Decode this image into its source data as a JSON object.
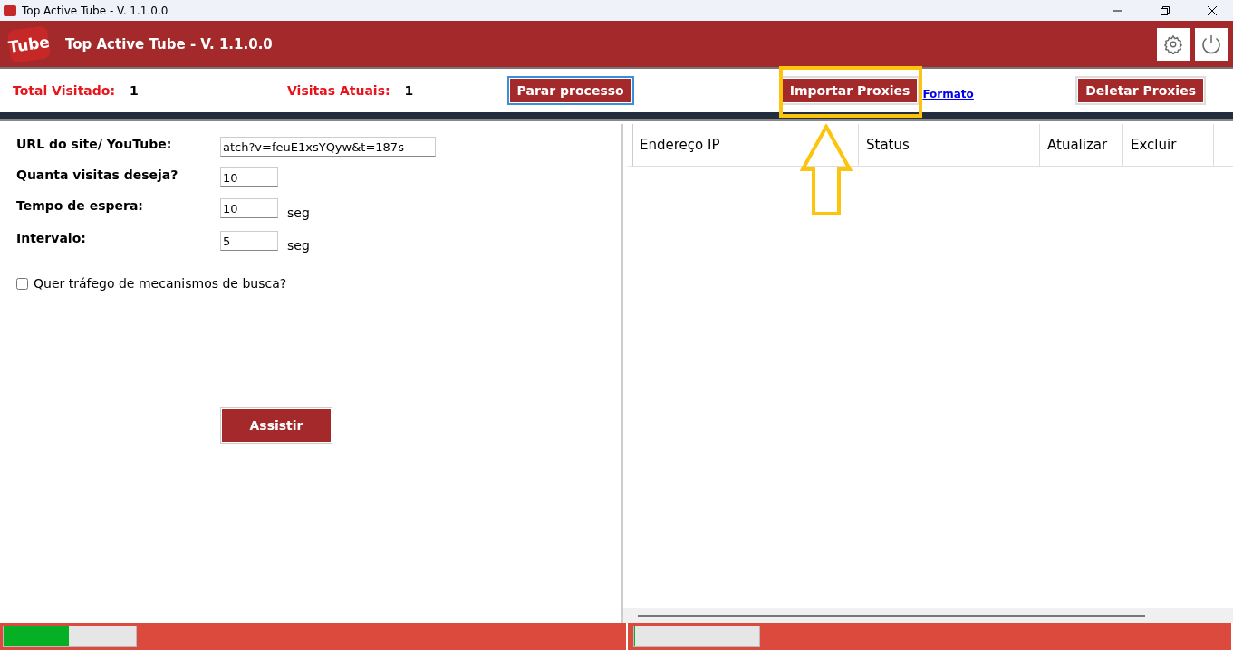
{
  "window": {
    "title": "Top Active Tube - V. 1.1.0.0"
  },
  "header": {
    "logo_text": "Tube",
    "title": "Top Active Tube - V. 1.1.0.0"
  },
  "stats": [
    {
      "label": "Total Visitado:",
      "value": "1"
    },
    {
      "label": "Visitas Atuais:",
      "value": "1"
    }
  ],
  "buttons": {
    "stop": "Parar processo",
    "import": "Importar Proxies",
    "format_link": "Formato",
    "delete": "Deletar Proxies"
  },
  "form": {
    "fields": [
      {
        "label": "URL do site/ YouTube:",
        "value": "atch?v=feuE1xsYQyw&t=187s",
        "kind": "wide"
      },
      {
        "label": "Quanta visitas deseja?",
        "value": "10",
        "kind": "short"
      },
      {
        "label": "Tempo de espera:",
        "value": "10",
        "kind": "short",
        "unit": "seg"
      },
      {
        "label": "Intervalo:",
        "value": "5",
        "kind": "short",
        "unit": "seg"
      }
    ],
    "checkbox": {
      "label": "Quer tráfego de mecanismos de busca?",
      "checked": false
    },
    "submit": "Assistir"
  },
  "table": {
    "columns": [
      "Endereço IP",
      "Status",
      "Atualizar",
      "Excluir"
    ]
  },
  "status_bar": {
    "left_progress": {
      "level": 0.49
    },
    "right_progress": {
      "level": 0
    }
  }
}
